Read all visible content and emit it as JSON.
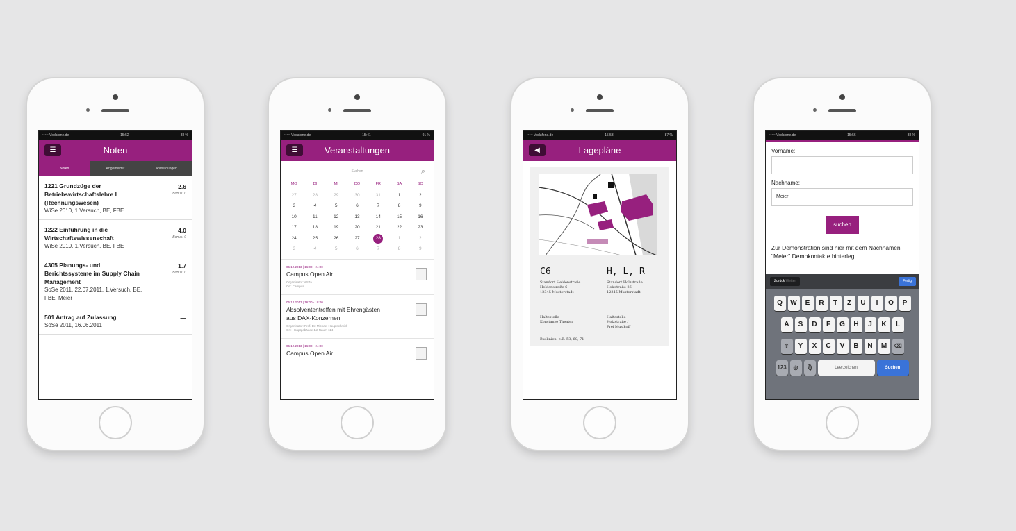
{
  "phones": [
    {
      "status": {
        "carrier": "••••• Vodafone.de",
        "time": "15:52",
        "battery": "88 %"
      },
      "title": "Noten",
      "tabs": [
        "Noten",
        "Angemeldet",
        "Anmeldungen"
      ],
      "grades": [
        {
          "title": "1221 Grundzüge der Betriebswirtschaftslehre I (Rechnungswesen)",
          "sub": "WiSe 2010, 1.Versuch, BE, FBE",
          "grade": "2.6",
          "bonus": "Bonus: 0"
        },
        {
          "title": "1222 Einführung in die Wirtschaftswissenschaft",
          "sub": "WiSe 2010, 1.Versuch, BE, FBE",
          "grade": "4.0",
          "bonus": "Bonus: 0"
        },
        {
          "title": "4305 Planungs- und Berichtssysteme im Supply Chain Management",
          "sub": "SoSe 2011, 22.07.2011, 1.Versuch, BE, FBE, Meier",
          "grade": "1.7",
          "bonus": "Bonus: 0"
        },
        {
          "title": "501 Antrag auf Zulassung",
          "sub": "SoSe 2011, 16.06.2011",
          "grade": "—",
          "bonus": ""
        }
      ]
    },
    {
      "status": {
        "carrier": "••••• Vodafone.de",
        "time": "15:41",
        "battery": "91 %"
      },
      "title": "Veranstaltungen",
      "search_placeholder": "Suchen",
      "weekdays": [
        "MO",
        "DI",
        "MI",
        "DO",
        "FR",
        "SA",
        "SO"
      ],
      "days": [
        "27",
        "28",
        "29",
        "30",
        "31",
        "1",
        "2",
        "3",
        "4",
        "5",
        "6",
        "7",
        "8",
        "9",
        "10",
        "11",
        "12",
        "13",
        "14",
        "15",
        "16",
        "17",
        "18",
        "19",
        "20",
        "21",
        "22",
        "23",
        "24",
        "25",
        "26",
        "27",
        "28",
        "1",
        "2",
        "3",
        "4",
        "5",
        "6",
        "7",
        "8",
        "9"
      ],
      "events": [
        {
          "date": "05.12.2013 | 16:00 - 24:00",
          "name": "Campus Open Air",
          "meta": "Organisator: ASTA\nOrt: Campus"
        },
        {
          "date": "05.12.2013 | 16:00 - 18:00",
          "name": "Absolvententreffen mit Ehrengästen aus DAX-Konzernen",
          "meta": "Organisator: Prof. Dr. Michael Hauptschmidt\nOrt: Hauptgebäude 1st Raum 114"
        },
        {
          "date": "05.12.2013 | 16:00 - 24:00",
          "name": "Campus Open Air",
          "meta": ""
        }
      ]
    },
    {
      "status": {
        "carrier": "••••• Vodafone.de",
        "time": "15:53",
        "battery": "87 %"
      },
      "title": "Lagepläne",
      "left": {
        "code": "C6",
        "addr": "Standort Heldenstraße\nHeldenstraße 6\n12345 Musterstadt",
        "hm": "Haltestelle\nKonstanze Theater",
        "fn": "Buslinien: z.B. 53, 60, 71"
      },
      "right": {
        "code": "H, L, R",
        "addr": "Standort Holzstraße\nHolzstraße 26\n12345 Musterstadt",
        "hm": "Haltestelle\nHolzstraße /\nFrei Musikoff"
      }
    },
    {
      "status": {
        "carrier": "••••• Vodafone.de",
        "time": "15:56",
        "battery": "88 %"
      },
      "form": {
        "vorname_label": "Vorname:",
        "vorname_value": "",
        "nachname_label": "Nachname:",
        "nachname_value": "Meier",
        "button": "suchen"
      },
      "demo_text": "Zur Demonstration sind hier mit dem Nachnamen \"Meier\" Demokontakte hinterlegt",
      "keyboard": {
        "back": "Zurück",
        "next": "Weiter",
        "done": "Fertig",
        "row1": [
          "Q",
          "W",
          "E",
          "R",
          "T",
          "Z",
          "U",
          "I",
          "O",
          "P"
        ],
        "row2": [
          "A",
          "S",
          "D",
          "F",
          "G",
          "H",
          "J",
          "K",
          "L"
        ],
        "row3": [
          "Y",
          "X",
          "C",
          "V",
          "B",
          "N",
          "M"
        ],
        "num": "123",
        "space": "Leerzeichen",
        "go": "Suchen"
      }
    }
  ]
}
